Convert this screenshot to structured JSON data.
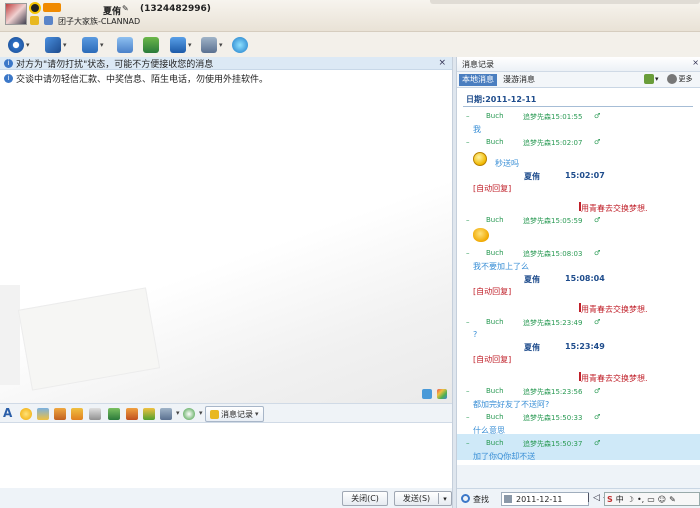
{
  "header": {
    "contact_name": "夏侑",
    "contact_qq": "(1324482996)",
    "signature": "团子大家族-CLANNAD"
  },
  "notice": {
    "text": "对方为\"请勿打扰\"状态，可能不方便接收您的消息",
    "close": "×",
    "tip": "交谈中请勿轻信汇款、中奖信息、陌生电话，勿使用外挂软件。"
  },
  "format_bar": {
    "font_icon": "A",
    "history_label": "消息记录"
  },
  "bottom": {
    "close_label": "关闭(C)",
    "send_label": "发送(S)",
    "send_caret": "▾"
  },
  "history": {
    "title": "消息记录",
    "close": "×",
    "tab_local": "本地消息",
    "tab_roam": "漫游消息",
    "more_label": "更多",
    "date_label": "日期:2011-12-11",
    "messages": [
      {
        "dash": "–",
        "name": "Buch",
        "from": "追梦先森15:01:55",
        "text": "我"
      },
      {
        "dash": "–",
        "name": "Buch",
        "from": "追梦先森15:02:07",
        "text": "秒送吗"
      },
      {
        "self_name": "夏侑",
        "self_time": "15:02:07",
        "auto": "[自动回复]",
        "signoff": "用青春去交换梦想."
      },
      {
        "dash": "–",
        "name": "Buch",
        "from": "追梦先森15:05:59"
      },
      {
        "dash": "–",
        "name": "Buch",
        "from": "追梦先森15:08:03",
        "text": "我不要加上了么"
      },
      {
        "self_name": "夏侑",
        "self_time": "15:08:04",
        "auto": "[自动回复]",
        "signoff": "用青春去交换梦想."
      },
      {
        "dash": "–",
        "name": "Buch",
        "from": "追梦先森15:23:49",
        "text": "?"
      },
      {
        "self_name": "夏侑",
        "self_time": "15:23:49",
        "auto": "[自动回复]",
        "signoff": "用青春去交换梦想."
      },
      {
        "dash": "–",
        "name": "Buch",
        "from": "追梦先森15:23:56",
        "text": "都加完好友了不送阿?"
      },
      {
        "dash": "–",
        "name": "Buch",
        "from": "追梦先森15:50:33",
        "text": "什么意思"
      },
      {
        "dash": "–",
        "name": "Buch",
        "from": "追梦先森15:50:37",
        "text": "加了你Q你却不送"
      }
    ],
    "footer_search": "查找",
    "footer_date": "2011-12-11",
    "pager": "|◁◁▷▷|"
  },
  "ime": {
    "label": "中"
  }
}
